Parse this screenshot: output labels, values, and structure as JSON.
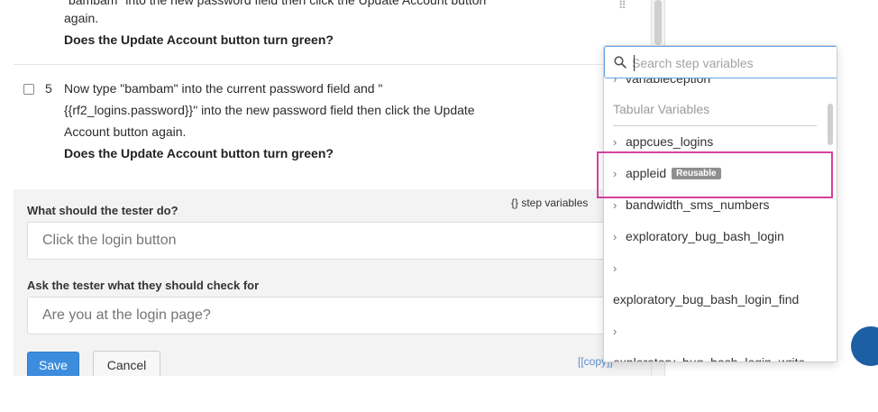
{
  "steps": {
    "prev": {
      "line1": "\"bambam\" into the new password field then click the Update Account button",
      "line2": "again.",
      "question": "Does the Update Account button turn green?"
    },
    "step5": {
      "number": "5",
      "line1": "Now type \"bambam\" into the current password field and \"",
      "line2": "{{rf2_logins.password}}\" into the new password field then click the Update",
      "line3": "Account button again.",
      "question": "Does the Update Account button turn green?"
    }
  },
  "form": {
    "tester_do_label": "What should the tester do?",
    "tester_do_placeholder": "Click the login button",
    "check_label": "Ask the tester what they should check for",
    "check_placeholder": "Are you at the login page?",
    "step_variables_link": "{} step variables",
    "save_label": "Save",
    "cancel_label": "Cancel",
    "copy_link": "[[copy]]"
  },
  "dropdown": {
    "search_placeholder": "Search step variables",
    "partial_item": "variableception",
    "group_label": "Tabular Variables",
    "items": [
      {
        "label": "appcues_logins",
        "badge": ""
      },
      {
        "label": "appleid",
        "badge": "Reusable"
      },
      {
        "label": "bandwidth_sms_numbers",
        "badge": ""
      },
      {
        "label": "exploratory_bug_bash_login",
        "badge": ""
      },
      {
        "label": "exploratory_bug_bash_login_find",
        "badge": ""
      },
      {
        "label": "exploratory_bug_bash_login_write",
        "badge": ""
      }
    ]
  },
  "colors": {
    "accent": "#3c8dde",
    "highlight": "#d6409f",
    "badge": "#8f8f8f"
  }
}
